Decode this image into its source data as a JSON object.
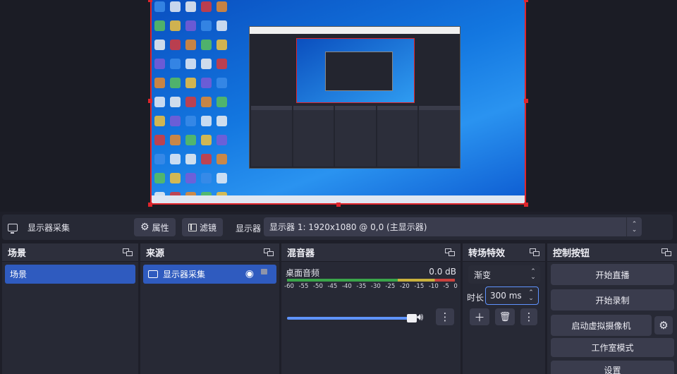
{
  "preview": {
    "desktop_icon_count": 60
  },
  "toolbar": {
    "source_name": "显示器采集",
    "properties_label": "属性",
    "filters_label": "滤镜",
    "display_label": "显示器",
    "display_value": "显示器 1: 1920x1080 @ 0,0 (主显示器)"
  },
  "scenes": {
    "title": "场景",
    "items": [
      {
        "label": "场景",
        "selected": true
      }
    ]
  },
  "sources": {
    "title": "来源",
    "items": [
      {
        "label": "显示器采集",
        "visible": true,
        "locked": false
      }
    ]
  },
  "mixer": {
    "title": "混音器",
    "track_name": "桌面音频",
    "level": "0.0 dB",
    "ticks": [
      "-60",
      "-55",
      "-50",
      "-45",
      "-40",
      "-35",
      "-30",
      "-25",
      "-20",
      "-15",
      "-10",
      "-5",
      "0"
    ],
    "volume_fraction": 1.0
  },
  "transitions": {
    "title": "转场特效",
    "selected": "渐变",
    "duration_label": "时长",
    "duration_value": "300 ms"
  },
  "controls": {
    "title": "控制按钮",
    "start_streaming": "开始直播",
    "start_recording": "开始录制",
    "virtual_camera": "启动虚拟摄像机",
    "studio_mode": "工作室模式",
    "settings": "设置"
  },
  "colors": {
    "accent": "#2f5bbf",
    "capture_border": "#e0252b",
    "dock_bg": "#272935",
    "app_bg": "#1e1f29"
  },
  "icons": [
    "monitor-icon",
    "gear-icon",
    "filter-icon",
    "eye-icon",
    "lock-icon",
    "undock-icon",
    "speaker-icon",
    "kebab-icon",
    "plus-icon",
    "trash-icon"
  ]
}
